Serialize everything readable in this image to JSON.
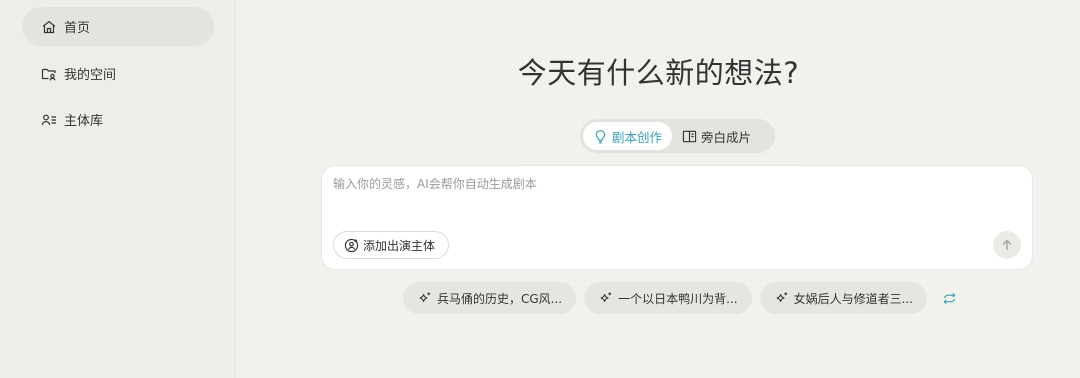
{
  "sidebar": {
    "items": [
      {
        "label": "首页",
        "icon": "home-icon",
        "active": true
      },
      {
        "label": "我的空间",
        "icon": "folder-user-icon",
        "active": false
      },
      {
        "label": "主体库",
        "icon": "user-list-icon",
        "active": false
      }
    ]
  },
  "main": {
    "headline": "今天有什么新的想法?",
    "tabs": [
      {
        "label": "剧本创作",
        "icon": "lightbulb-icon",
        "active": true
      },
      {
        "label": "旁白成片",
        "icon": "book-icon",
        "active": false
      }
    ],
    "prompt": {
      "placeholder": "输入你的灵感，AI会帮你自动生成剧本",
      "value": ""
    },
    "add_subject_label": "添加出演主体",
    "suggestions": [
      "兵马俑的历史，CG风...",
      "一个以日本鸭川为背...",
      "女娲后人与修道者三..."
    ]
  },
  "colors": {
    "accent": "#3a9fb0",
    "background": "#f1f1ed",
    "sidebar": "#eeeee9"
  }
}
